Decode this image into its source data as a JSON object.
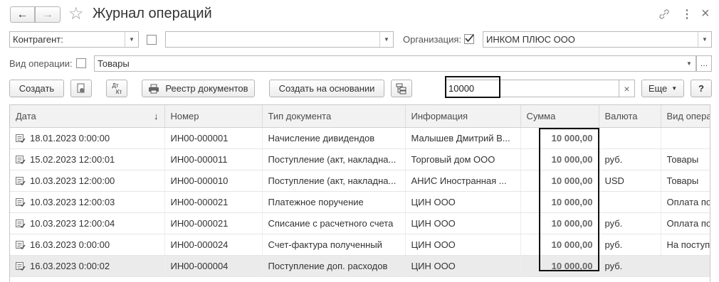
{
  "window": {
    "title": "Журнал операций",
    "nav_back": "←",
    "nav_forward": "→",
    "favorite_icon": "☆",
    "link_icon": "🔗",
    "more_icon": "⋮",
    "close_icon": "×"
  },
  "filters": {
    "counterparty_label": "Контрагент:",
    "counterparty_value": "",
    "organization_label": "Организация:",
    "organization_checked": true,
    "organization_value": "ИНКОМ ПЛЮС ООО",
    "operation_type_label": "Вид операции:",
    "operation_type_checked": false,
    "operation_type_value": "Товары"
  },
  "toolbar": {
    "create_label": "Создать",
    "dt_kt_top": "Дт",
    "dt_kt_bottom": "Кт",
    "registry_label": "Реестр документов",
    "create_based_label": "Создать на основании",
    "search_value": "10000",
    "search_clear": "×",
    "more_label": "Еще",
    "help_label": "?"
  },
  "table": {
    "columns": [
      "Дата",
      "Номер",
      "Тип документа",
      "Информация",
      "Сумма",
      "Валюта",
      "Вид опера"
    ],
    "sort_indicator": "↓",
    "rows": [
      {
        "date": "18.01.2023 0:00:00",
        "number": "ИН00-000001",
        "type": "Начисление дивидендов",
        "info": "Малышев Дмитрий В...",
        "sum": "10 000,00",
        "currency": "",
        "op": ""
      },
      {
        "date": "15.02.2023 12:00:01",
        "number": "ИН00-000011",
        "type": "Поступление (акт, накладна...",
        "info": "Торговый дом ООО",
        "sum": "10 000,00",
        "currency": "руб.",
        "op": "Товары"
      },
      {
        "date": "10.03.2023 12:00:00",
        "number": "ИН00-000010",
        "type": "Поступление (акт, накладна...",
        "info": "АНИС  Иностранная ...",
        "sum": "10 000,00",
        "currency": "USD",
        "op": "Товары"
      },
      {
        "date": "10.03.2023 12:00:03",
        "number": "ИН00-000021",
        "type": "Платежное поручение",
        "info": "ЦИН ООО",
        "sum": "10 000,00",
        "currency": "",
        "op": "Оплата пос"
      },
      {
        "date": "10.03.2023 12:00:04",
        "number": "ИН00-000021",
        "type": "Списание с расчетного счета",
        "info": "ЦИН ООО",
        "sum": "10 000,00",
        "currency": "руб.",
        "op": "Оплата пос"
      },
      {
        "date": "16.03.2023 0:00:00",
        "number": "ИН00-000024",
        "type": "Счет-фактура полученный",
        "info": "ЦИН ООО",
        "sum": "10 000,00",
        "currency": "руб.",
        "op": "На поступл"
      },
      {
        "date": "16.03.2023 0:00:02",
        "number": "ИН00-000004",
        "type": "Поступление доп. расходов",
        "info": "ЦИН ООО",
        "sum": "10 000,00",
        "currency": "руб.",
        "op": ""
      }
    ]
  }
}
